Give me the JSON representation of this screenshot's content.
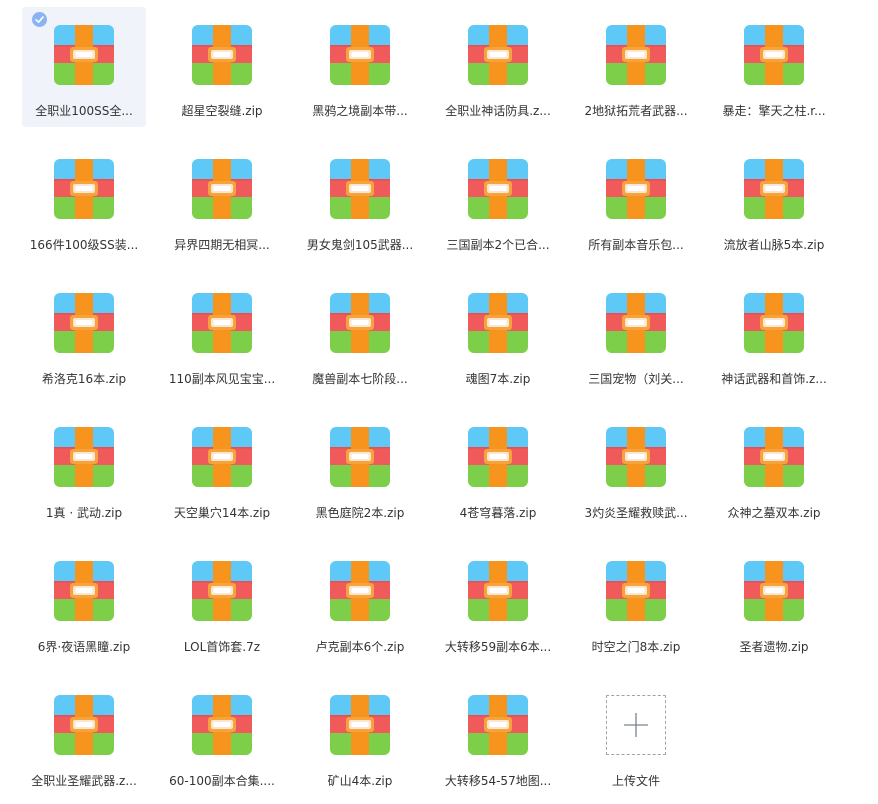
{
  "files": [
    {
      "name": "全职业100SS全...",
      "selected": true
    },
    {
      "name": "超星空裂缝.zip"
    },
    {
      "name": "黑鸦之境副本带..."
    },
    {
      "name": "全职业神话防具.z..."
    },
    {
      "name": "2地狱拓荒者武器..."
    },
    {
      "name": "暴走：擎天之柱.r..."
    },
    {
      "name": "166件100级SS装..."
    },
    {
      "name": "异界四期无相冥..."
    },
    {
      "name": "男女鬼剑105武器..."
    },
    {
      "name": "三国副本2个已合..."
    },
    {
      "name": "所有副本音乐包..."
    },
    {
      "name": "流放者山脉5本.zip"
    },
    {
      "name": "希洛克16本.zip"
    },
    {
      "name": "110副本风见宝宝..."
    },
    {
      "name": "魔兽副本七阶段..."
    },
    {
      "name": "魂图7本.zip"
    },
    {
      "name": "三国宠物（刘关..."
    },
    {
      "name": "神话武器和首饰.z..."
    },
    {
      "name": "1真 · 武动.zip"
    },
    {
      "name": "天空巢穴14本.zip"
    },
    {
      "name": "黑色庭院2本.zip"
    },
    {
      "name": "4苍穹暮落.zip"
    },
    {
      "name": "3灼炎圣耀救赎武..."
    },
    {
      "name": "众神之墓双本.zip"
    },
    {
      "name": "6界·夜语黑瞳.zip"
    },
    {
      "name": "LOL首饰套.7z"
    },
    {
      "name": "卢克副本6个.zip"
    },
    {
      "name": "大转移59副本6本..."
    },
    {
      "name": "时空之门8本.zip"
    },
    {
      "name": "圣者遗物.zip"
    },
    {
      "name": "全职业圣耀武器.z..."
    },
    {
      "name": "60-100副本合集...."
    },
    {
      "name": "矿山4本.zip"
    },
    {
      "name": "大转移54-57地图..."
    }
  ],
  "upload": {
    "label": "上传文件"
  },
  "icons": {
    "file": "zip-archive-icon",
    "selected": "check-icon",
    "upload": "plus-icon"
  },
  "colors": {
    "archive_top": "#5ec8f7",
    "archive_middle": "#f05a5a",
    "archive_bottom": "#7dcf4a",
    "archive_strap": "#f7941d",
    "selection_background": "#f0f3fa",
    "check": "#8bb3f3",
    "text": "#333333"
  }
}
